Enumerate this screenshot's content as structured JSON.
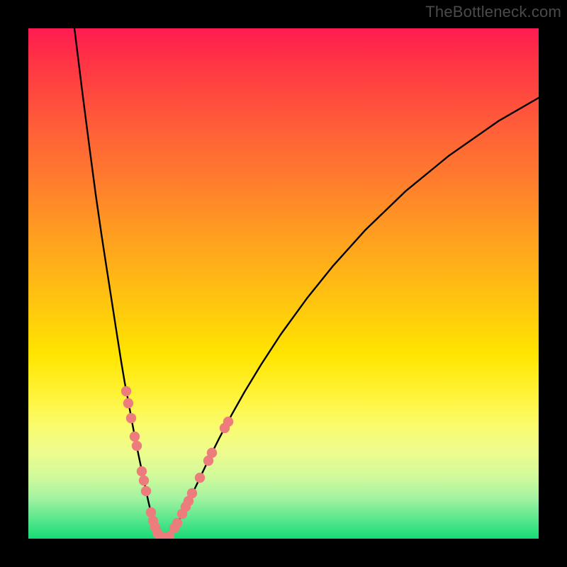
{
  "watermark": "TheBottleneck.com",
  "chart_data": {
    "type": "line",
    "title": "",
    "xlabel": "",
    "ylabel": "",
    "xlim": [
      0,
      100
    ],
    "ylim": [
      0,
      100
    ],
    "grid": false,
    "legend": false,
    "series": [
      {
        "name": "curve-left",
        "color": "#000000",
        "x": [
          9.03,
          10.56,
          11.94,
          13.19,
          14.31,
          15.42,
          16.39,
          17.36,
          18.19,
          18.89,
          19.58,
          20.28,
          20.83,
          21.39,
          21.94,
          22.5,
          23.06,
          23.47,
          23.89,
          24.31,
          24.58,
          25.14,
          26.25
        ],
        "y": [
          100.0,
          87.64,
          76.94,
          67.5,
          59.72,
          52.5,
          46.25,
          40.0,
          34.72,
          30.56,
          26.94,
          23.06,
          20.14,
          17.36,
          14.72,
          12.08,
          9.44,
          7.5,
          5.69,
          4.03,
          2.92,
          1.25,
          0.28
        ]
      },
      {
        "name": "curve-right",
        "color": "#000000",
        "x": [
          27.5,
          28.47,
          29.31,
          30.42,
          31.39,
          32.64,
          34.03,
          35.69,
          37.5,
          39.86,
          42.36,
          45.56,
          49.44,
          54.58,
          59.72,
          66.11,
          73.89,
          82.36,
          92.08,
          100.0
        ],
        "y": [
          0.28,
          1.67,
          3.19,
          5.28,
          7.36,
          9.86,
          12.78,
          16.25,
          19.86,
          24.31,
          28.75,
          34.03,
          40.0,
          47.08,
          53.47,
          60.56,
          68.06,
          75.0,
          81.81,
          86.39
        ]
      }
    ],
    "highlight_points": {
      "name": "marker-dots",
      "color": "#ed7d7d",
      "points": [
        {
          "x": 19.17,
          "y": 28.89
        },
        {
          "x": 19.58,
          "y": 26.53
        },
        {
          "x": 20.14,
          "y": 23.61
        },
        {
          "x": 20.83,
          "y": 20.0
        },
        {
          "x": 21.25,
          "y": 18.19
        },
        {
          "x": 22.22,
          "y": 13.19
        },
        {
          "x": 22.64,
          "y": 11.39
        },
        {
          "x": 23.06,
          "y": 9.31
        },
        {
          "x": 24.03,
          "y": 5.14
        },
        {
          "x": 24.44,
          "y": 3.47
        },
        {
          "x": 24.86,
          "y": 2.22
        },
        {
          "x": 25.28,
          "y": 1.11
        },
        {
          "x": 25.83,
          "y": 0.42
        },
        {
          "x": 26.67,
          "y": 0.28
        },
        {
          "x": 27.64,
          "y": 0.42
        },
        {
          "x": 28.61,
          "y": 2.08
        },
        {
          "x": 29.17,
          "y": 3.06
        },
        {
          "x": 30.14,
          "y": 4.86
        },
        {
          "x": 30.83,
          "y": 6.25
        },
        {
          "x": 31.39,
          "y": 7.36
        },
        {
          "x": 32.08,
          "y": 8.89
        },
        {
          "x": 33.61,
          "y": 11.94
        },
        {
          "x": 35.28,
          "y": 15.28
        },
        {
          "x": 35.97,
          "y": 16.81
        },
        {
          "x": 38.47,
          "y": 21.67
        },
        {
          "x": 39.17,
          "y": 22.92
        }
      ]
    }
  }
}
